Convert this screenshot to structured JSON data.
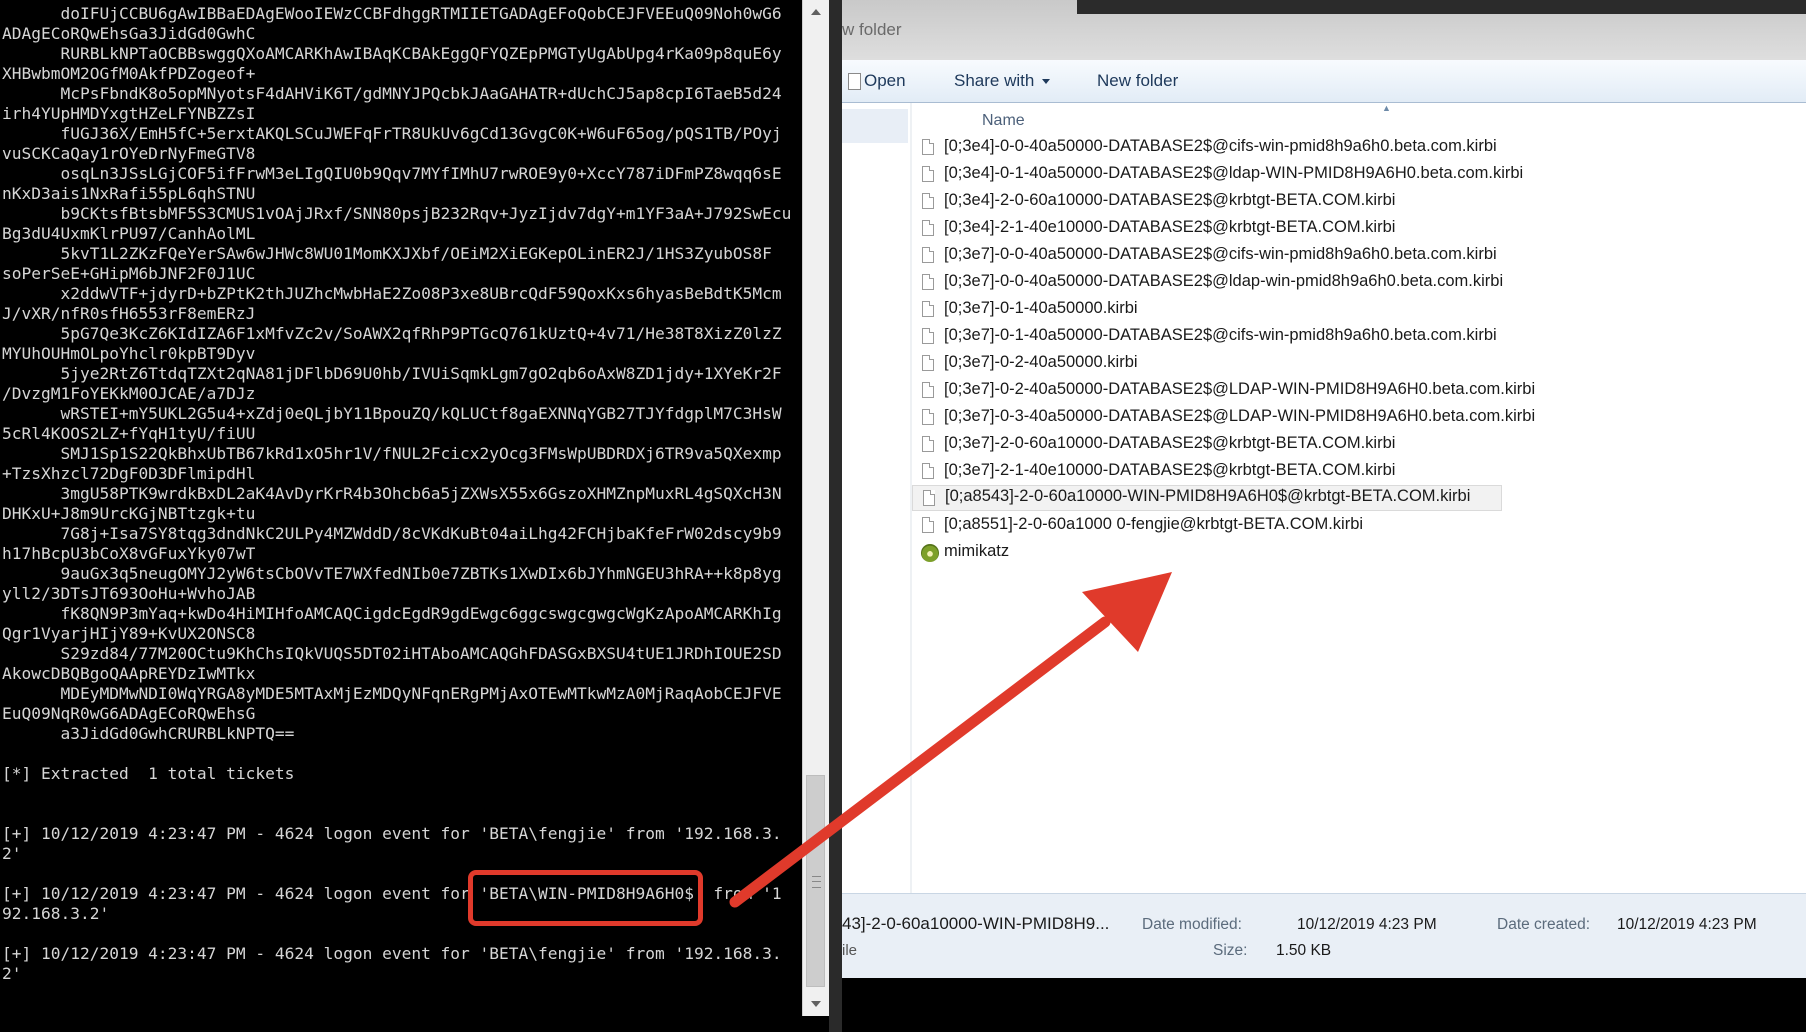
{
  "console": {
    "lines": [
      "      doIFUjCCBU6gAwIBBaEDAgEWooIEWzCCBFdhggRTMIIETGADAgEFoQobCEJFVEEuQ09Noh0wG6",
      "ADAgECoRQwEhsGa3JidGd0GwhC",
      "      RURBLkNPTaOCBBswggQXoAMCARKhAwIBAqKCBAkEggQFYQZEpPMGTyUgAbUpg4rKa09p8quE6y",
      "XHBwbmOM2OGfM0AkfPDZogeof+",
      "      McPsFbndK8o5opMNyotsF4dAHViK6T/gdMNYJPQcbkJAaGAHATR+dUchCJ5ap8cpI6TaeB5d24",
      "irh4YUpHMDYxgtHZeLFYNBZZsI",
      "      fUGJ36X/EmH5fC+5erxtAKQLSCuJWEFqFrTR8UkUv6gCd13GvgC0K+W6uF65og/pQS1TB/POyj",
      "vuSCKCaQay1rOYeDrNyFmeGTV8",
      "      osqLn3JSsLGjCOF5ifFrwM3eLIgQIU0b9Qqv7MYfIMhU7rwROE9y0+XccY787iDFmPZ8wqq6sE",
      "nKxD3ais1NxRafi55pL6qhSTNU",
      "      b9CKtsfBtsbMF5S3CMUS1vOAjJRxf/SNN80psjB232Rqv+JyzIjdv7dgY+m1YF3aA+J792SwEcu",
      "Bg3dU4UxmKlrPU97/CanhAolML",
      "      5kvT1L2ZKzFQeYerSAw6wJHWc8WU01MomKXJXbf/OEiM2XiEGKepOLinER2J/1HS3ZyubOS8F",
      "soPerSeE+GHipM6bJNF2F0J1UC",
      "      x2ddwVTF+jdyrD+bZPtK2thJUZhcMwbHaE2Zo08P3xe8UBrcQdF59QoxKxs6hyasBeBdtK5Mcm",
      "J/vXR/nfR0sfH6553rF8emERzJ",
      "      5pG7Qe3KcZ6KIdIZA6F1xMfvZc2v/SoAWX2qfRhP9PTGcQ761kUztQ+4v71/He38T8XizZ0lzZ",
      "MYUhOUHmOLpoYhclr0kpBT9Dyv",
      "      5jye2RtZ6TtdqTZXt2qNA81jDFlbD69U0hb/IVUiSqmkLgm7gO2qb6oAxW8ZD1jdy+1XYeKr2F",
      "/DvzgM1FoYEKkM0OJCAE/a7DJz",
      "      wRSTEI+mY5UKL2G5u4+xZdj0eQLjbY11BpouZQ/kQLUCtf8gaEXNNqYGB27TJYfdgplM7C3HsW",
      "5cRl4KOOS2LZ+fYqH1tyU/fiUU",
      "      SMJ1Sp1S22QkBhxUbTB67kRd1xO5hr1V/fNUL2Fcicx2yOcg3FMsWpUBDRDXj6TR9va5QXexmp",
      "+TzsXhzcl72DgF0D3DFlmipdHl",
      "      3mgU58PTK9wrdkBxDL2aK4AvDyrKrR4b3Ohcb6a5jZXWsX55x6GszoXHMZnpMuxRL4gSQXcH3N",
      "DHKxU+J8m9UrcKGjNBTtzgk+tu",
      "      7G8j+Isa7SY8tqg3dndNkC2ULPy4MZWddD/8cVKdKuBt04aiLhg42FCHjbaKfeFrW02dscy9b9",
      "h17hBcpU3bCoX8vGFuxYky07wT",
      "      9auGx3q5neugOMYJ2yW6tsCbOVvTE7WXfedNIb0e7ZBTKs1XwDIx6bJYhmNGEU3hRA++k8p8yg",
      "yll2/3DTsJT693OoHu+WvhoJAB",
      "      fK8QN9P3mYaq+kwDo4HiMIHfoAMCAQCigdcEgdR9gdEwgc6ggcswgcgwgcWgKzApoAMCARKhIg",
      "Qgr1VyarjHIjY89+KvUX2ONSC8",
      "      S29zd84/77M20OCtu9KhChsIQkVUQS5DT02iHTAboAMCAQGhFDASGxBXSU4tUE1JRDhIOUE2SD",
      "AkowcDBQBgoQAApREYDzIwMTkx",
      "      MDEyMDMwNDI0WqYRGA8yMDE5MTAxMjEzMDQyNFqnERgPMjAxOTEwMTkwMzA0MjRaqAobCEJFVE",
      "EuQ09NqR0wG6ADAgECoRQwEhsG",
      "      a3JidGd0GwhCRURBLkNPTQ==",
      "",
      "[*] Extracted  1 total tickets",
      "",
      "",
      "[+] 10/12/2019 4:23:47 PM - 4624 logon event for 'BETA\\fengjie' from '192.168.3.",
      "2'",
      "",
      "[+] 10/12/2019 4:23:47 PM - 4624 logon event for 'BETA\\WIN-PMID8H9A6H0$' from '1",
      "92.168.3.2'",
      "",
      "[+] 10/12/2019 4:23:47 PM - 4624 logon event for 'BETA\\fengjie' from '192.168.3.",
      "2'"
    ]
  },
  "explorer": {
    "window_title": "w folder",
    "toolbar": {
      "open": "Open",
      "share_with": "Share with",
      "new_folder": "New folder"
    },
    "column_name": "Name",
    "files": [
      "[0;3e4]-0-0-40a50000-DATABASE2$@cifs-win-pmid8h9a6h0.beta.com.kirbi",
      "[0;3e4]-0-1-40a50000-DATABASE2$@ldap-WIN-PMID8H9A6H0.beta.com.kirbi",
      "[0;3e4]-2-0-60a10000-DATABASE2$@krbtgt-BETA.COM.kirbi",
      "[0;3e4]-2-1-40e10000-DATABASE2$@krbtgt-BETA.COM.kirbi",
      "[0;3e7]-0-0-40a50000-DATABASE2$@cifs-win-pmid8h9a6h0.beta.com.kirbi",
      "[0;3e7]-0-0-40a50000-DATABASE2$@ldap-win-pmid8h9a6h0.beta.com.kirbi",
      "[0;3e7]-0-1-40a50000.kirbi",
      "[0;3e7]-0-1-40a50000-DATABASE2$@cifs-win-pmid8h9a6h0.beta.com.kirbi",
      "[0;3e7]-0-2-40a50000.kirbi",
      "[0;3e7]-0-2-40a50000-DATABASE2$@LDAP-WIN-PMID8H9A6H0.beta.com.kirbi",
      "[0;3e7]-0-3-40a50000-DATABASE2$@LDAP-WIN-PMID8H9A6H0.beta.com.kirbi",
      "[0;3e7]-2-0-60a10000-DATABASE2$@krbtgt-BETA.COM.kirbi",
      "[0;3e7]-2-1-40e10000-DATABASE2$@krbtgt-BETA.COM.kirbi",
      "[0;a8543]-2-0-60a10000-WIN-PMID8H9A6H0$@krbtgt-BETA.COM.kirbi",
      "[0;a8551]-2-0-60a1000 0-fengjie@krbtgt-BETA.COM.kirbi",
      "mimikatz"
    ],
    "details": {
      "filename": "43]-2-0-60a10000-WIN-PMID8H9...",
      "type": "ile",
      "date_modified_label": "Date modified:",
      "date_modified": "10/12/2019 4:23 PM",
      "date_created_label": "Date created:",
      "date_created": "10/12/2019 4:23 PM",
      "size_label": "Size:",
      "size": "1.50 KB"
    }
  },
  "annotation": {
    "color": "#e03a2b"
  }
}
